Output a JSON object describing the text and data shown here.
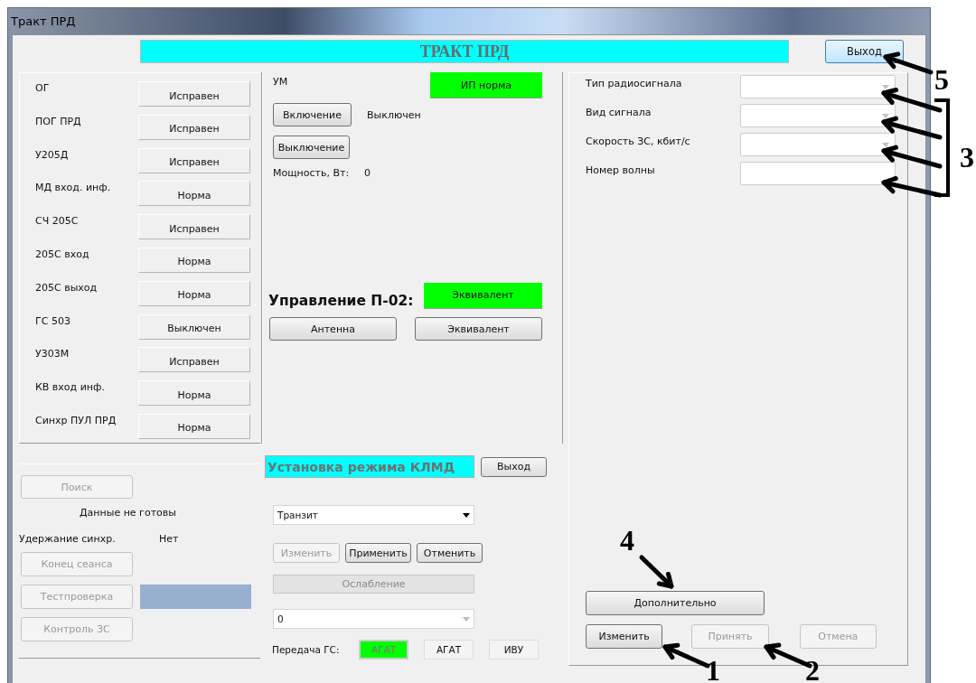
{
  "window": {
    "title": "Тракт ПРД"
  },
  "header": {
    "title": "ТРАКТ ПРД",
    "exit_button": "Выход"
  },
  "devices": [
    {
      "label": "ОГ",
      "status": "Исправен"
    },
    {
      "label": "ПОГ ПРД",
      "status": "Исправен"
    },
    {
      "label": "У205Д",
      "status": "Исправен"
    },
    {
      "label": "МД вход. инф.",
      "status": "Норма"
    },
    {
      "label": "СЧ 205С",
      "status": "Исправен"
    },
    {
      "label": "205С вход",
      "status": "Норма"
    },
    {
      "label": "205С выход",
      "status": "Норма"
    },
    {
      "label": "ГС 503",
      "status": "Выключен"
    },
    {
      "label": "У303М",
      "status": "Исправен"
    },
    {
      "label": "КВ вход инф.",
      "status": "Норма"
    },
    {
      "label": "Синхр ПУЛ ПРД",
      "status": "Норма"
    }
  ],
  "um": {
    "label": "УМ",
    "indicator": "ИП норма",
    "on_button": "Включение",
    "state": "Выключен",
    "off_button": "Выключение",
    "power_label": "Мощность, Вт:",
    "power_value": "0"
  },
  "p02": {
    "label": "Управление П-02:",
    "indicator": "Эквивалент",
    "buttons": [
      "Антенна",
      "Эквивалент"
    ]
  },
  "session": {
    "search_button": {
      "label": "Поиск",
      "disabled": true
    },
    "data_status": "Данные не готовы",
    "sync_label": "Удержание синхр.",
    "sync_value": "Нет",
    "buttons": [
      {
        "label": "Конец сеанса",
        "disabled": true
      },
      {
        "label": "Тестпроверка",
        "disabled": true
      },
      {
        "label": "Контроль ЗС",
        "disabled": true
      }
    ]
  },
  "klmd": {
    "title": "Установка режима КЛМД",
    "exit_button": "Выход",
    "mode_select": "Транзит",
    "buttons": [
      {
        "label": "Изменить",
        "disabled": true
      },
      {
        "label": "Применить",
        "disabled": false
      },
      {
        "label": "Отменить",
        "disabled": false
      }
    ],
    "attenuation_button": {
      "label": "Ослабление",
      "disabled": true
    },
    "attenuation_select": "0",
    "transfer_label": "Передача ГС:",
    "transfer_options": [
      {
        "label": "АГАТ",
        "selected": true
      },
      {
        "label": "АГАТ",
        "selected": false
      },
      {
        "label": "ИВУ",
        "selected": false
      }
    ]
  },
  "params": [
    {
      "label": "Тип радиосигнала",
      "kind": "select"
    },
    {
      "label": "Вид сигнала",
      "kind": "select"
    },
    {
      "label": "Скорость ЗС, кбит/с",
      "kind": "select"
    },
    {
      "label": "Номер волны",
      "kind": "input"
    }
  ],
  "more_button": "Дополнительно",
  "actions": [
    {
      "label": "Изменить",
      "disabled": false
    },
    {
      "label": "Принять",
      "disabled": true
    },
    {
      "label": "Отмена",
      "disabled": true
    }
  ],
  "annotations": [
    {
      "label": "5"
    },
    {
      "label": "3"
    },
    {
      "label": "4"
    },
    {
      "label": "1"
    },
    {
      "label": "2"
    }
  ]
}
